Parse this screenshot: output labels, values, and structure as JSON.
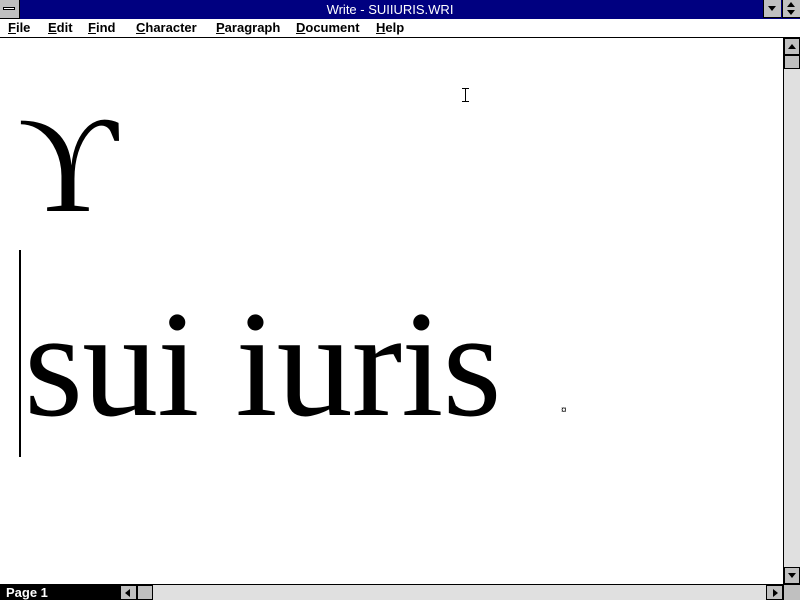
{
  "window": {
    "title": "Write - SUIIURIS.WRI"
  },
  "menu": {
    "items": [
      {
        "label": "File"
      },
      {
        "label": "Edit"
      },
      {
        "label": "Find"
      },
      {
        "label": "Character"
      },
      {
        "label": "Paragraph"
      },
      {
        "label": "Document"
      },
      {
        "label": "Help"
      }
    ]
  },
  "document": {
    "symbol": "ϒ",
    "text": "sui iuris",
    "paragraph_mark": "¤"
  },
  "status": {
    "page_label": "Page 1"
  },
  "colors": {
    "titlebar": "#000080",
    "titletext": "#ffffff",
    "chrome": "#c0c0c0",
    "page_indicator_bg": "#000000"
  },
  "icons": {
    "system_menu": "system-menu-icon",
    "minimize": "minimize-arrow-icon",
    "maximize": "maximize-arrow-icon",
    "scroll_up": "arrow-up-icon",
    "scroll_down": "arrow-down-icon",
    "scroll_left": "arrow-left-icon",
    "scroll_right": "arrow-right-icon",
    "cursor": "ibeam-cursor-icon"
  }
}
